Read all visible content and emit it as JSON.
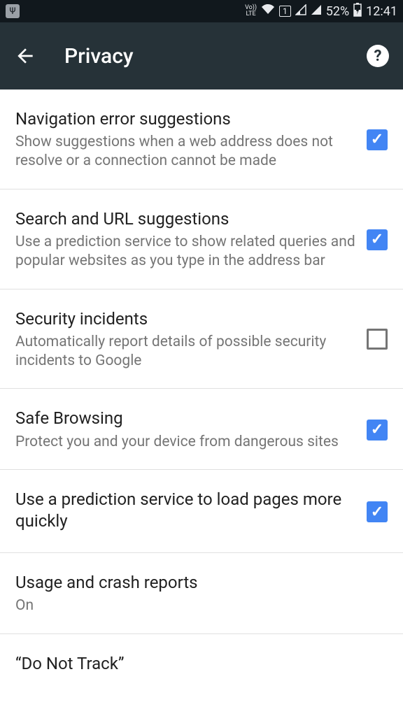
{
  "status_bar": {
    "lte": "Vo))\nLTE",
    "sim": "1",
    "battery_pct": "52%",
    "time": "12:41"
  },
  "header": {
    "title": "Privacy"
  },
  "settings": [
    {
      "title": "Navigation error suggestions",
      "desc": "Show suggestions when a web address does not resolve or a connection cannot be made",
      "checked": true,
      "has_checkbox": true
    },
    {
      "title": "Search and URL suggestions",
      "desc": "Use a prediction service to show related queries and popular websites as you type in the address bar",
      "checked": true,
      "has_checkbox": true
    },
    {
      "title": "Security incidents",
      "desc": "Automatically report details of possible security incidents to Google",
      "checked": false,
      "has_checkbox": true
    },
    {
      "title": "Safe Browsing",
      "desc": "Protect you and your device from dangerous sites",
      "checked": true,
      "has_checkbox": true
    },
    {
      "title": "Use a prediction service to load pages more quickly",
      "desc": "",
      "checked": true,
      "has_checkbox": true
    },
    {
      "title": "Usage and crash reports",
      "desc": "On",
      "has_checkbox": false
    },
    {
      "title": "“Do Not Track”",
      "desc": "",
      "has_checkbox": false
    }
  ]
}
